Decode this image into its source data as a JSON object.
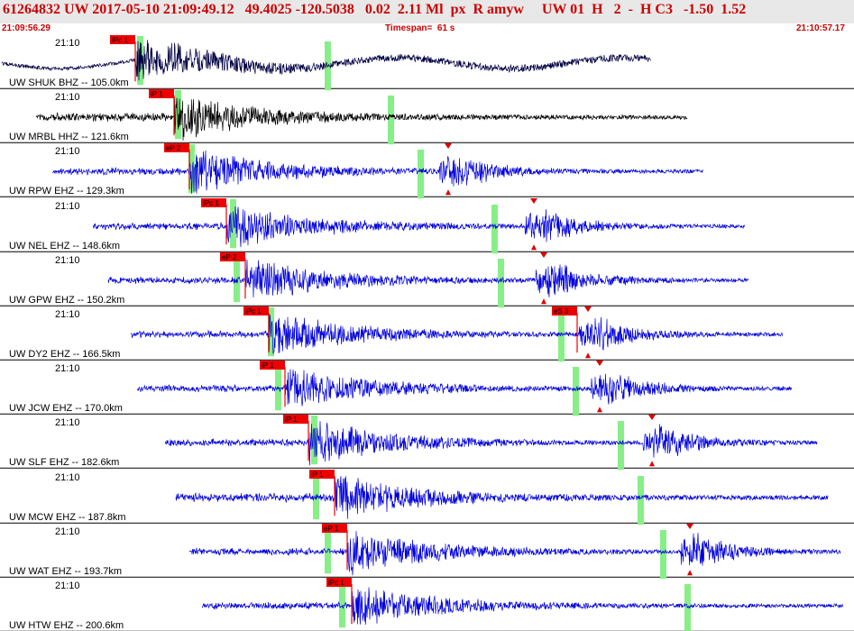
{
  "header": {
    "title": "61264832 UW 2017-05-10 21:09:49.12   49.4025 -120.5038   0.02  2.11 Ml  px  R amyw     UW 01  H   2  -  H C3   -1.50  1.52",
    "start_time": "21:09:56.29",
    "timespan": "Timespan=  61 s",
    "end_time": "21:10:57.17"
  },
  "colors": {
    "pick": "#ee0000",
    "window": "#88ee88",
    "trace_dark": "#000044",
    "trace_black": "#000000",
    "trace_blue": "#0000dd",
    "header_text": "#cc0000"
  },
  "traces": [
    {
      "time": "21:10",
      "label": "UW SHUK BHZ -- 105.0km",
      "pick": "iPc 1",
      "color": "dark",
      "events": [
        {
          "t": 0.0,
          "w": 1
        },
        {
          "t": 0.5,
          "w": 0
        }
      ]
    },
    {
      "time": "21:10",
      "label": "UW MRBL HHZ -- 121.6km",
      "pick": "iP 1",
      "color": "black",
      "events": [
        {
          "t": 0.0,
          "w": 1
        }
      ]
    },
    {
      "time": "21:10",
      "label": "UW RPW EHZ -- 129.3km",
      "pick": "eP 2",
      "color": "blue",
      "events": [
        {
          "t": 0.0,
          "w": 1
        },
        {
          "t": 0.5,
          "w": 1
        }
      ],
      "amp": "arrow"
    },
    {
      "time": "21:10",
      "label": "UW NEL EHZ -- 148.6km",
      "pick": "iPc 1",
      "color": "blue",
      "events": [
        {
          "t": 0.0,
          "w": 1
        },
        {
          "t": 0.5,
          "w": 1
        }
      ],
      "amp": "arrow"
    },
    {
      "time": "21:10",
      "label": "UW GPW EHZ -- 150.2km",
      "pick": "eP 2",
      "color": "blue",
      "events": [
        {
          "t": 0.0,
          "w": 1
        },
        {
          "t": 0.5,
          "w": 1
        }
      ],
      "amp": "arrow"
    },
    {
      "time": "21:10",
      "label": "UW DY2 EHZ -- 166.5km",
      "pick": "iPc 1",
      "color": "blue",
      "events": [
        {
          "t": 0.0,
          "w": 1
        },
        {
          "t": 0.5,
          "w": 1
        }
      ],
      "amp": "arrow",
      "spick": "eS 3"
    },
    {
      "time": "21:10",
      "label": "UW JCW EHZ -- 170.0km",
      "pick": "iP 1",
      "color": "blue",
      "events": [
        {
          "t": 0.0,
          "w": 1
        },
        {
          "t": 0.5,
          "w": 1
        }
      ],
      "amp": "arrow"
    },
    {
      "time": "21:10",
      "label": "UW SLF EHZ -- 182.6km",
      "pick": "iP 1",
      "color": "blue",
      "events": [
        {
          "t": 0.0,
          "w": 1
        },
        {
          "t": 0.5,
          "w": 1
        }
      ],
      "amp": "arrow"
    },
    {
      "time": "21:10",
      "label": "UW MCW EHZ -- 187.8km",
      "pick": "iP 1",
      "color": "blue",
      "events": [
        {
          "t": 0.0,
          "w": 1
        },
        {
          "t": 0.5,
          "w": 1
        }
      ]
    },
    {
      "time": "21:10",
      "label": "UW WAT EHZ -- 193.7km",
      "pick": "eP 1",
      "color": "blue",
      "events": [
        {
          "t": 0.0,
          "w": 1
        },
        {
          "t": 0.5,
          "w": 1
        }
      ],
      "amp": "arrow"
    },
    {
      "time": "21:10",
      "label": "UW HTW EHZ -- 200.6km",
      "pick": "iPc 1",
      "color": "blue",
      "events": [
        {
          "t": 0.0,
          "w": 1
        },
        {
          "t": 0.5,
          "w": 1
        }
      ],
      "amp": "arrow"
    }
  ]
}
